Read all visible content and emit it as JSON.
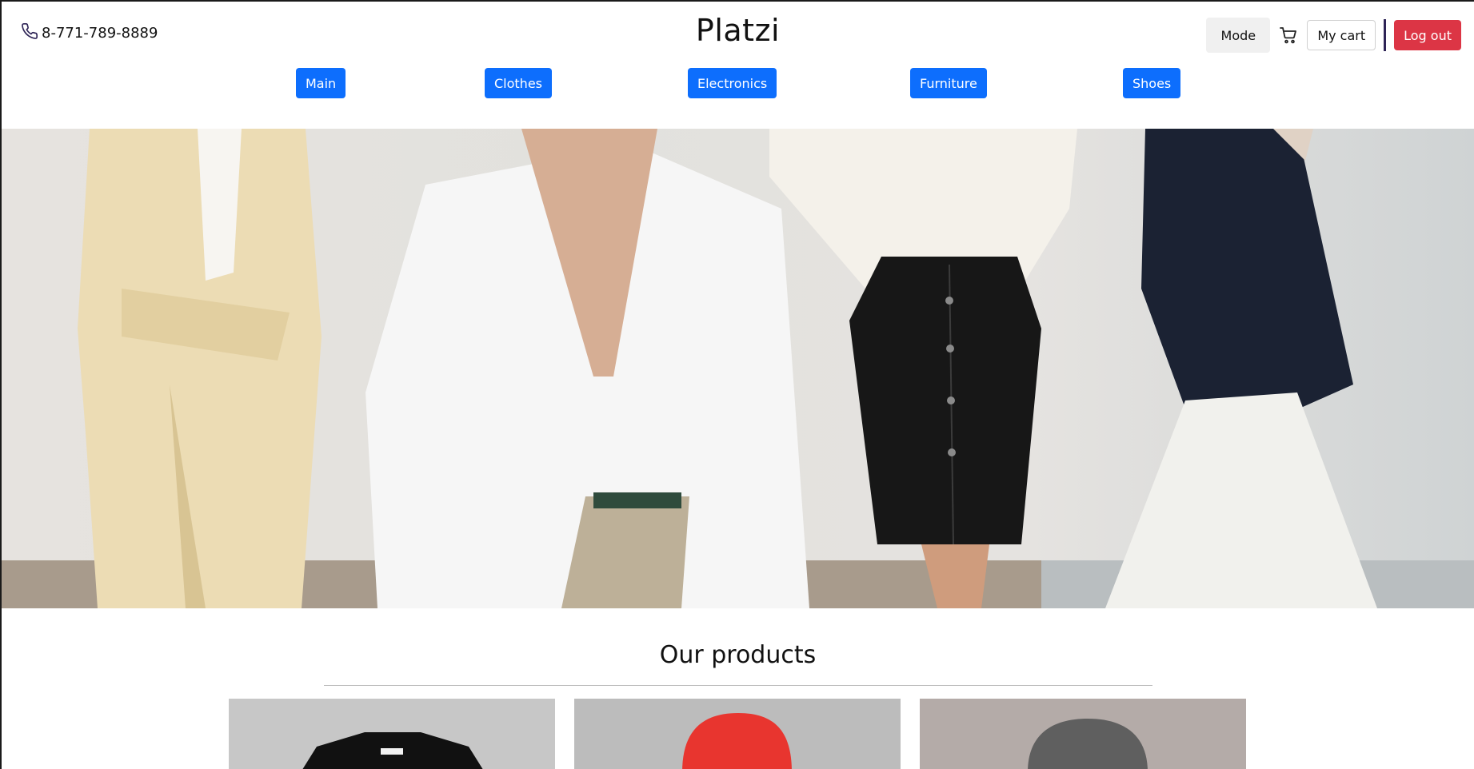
{
  "header": {
    "phone": "8-771-789-8889",
    "brand": "Platzi",
    "mode_label": "Mode",
    "cart_label": "My cart",
    "logout_label": "Log out"
  },
  "nav": {
    "categories": [
      "Main",
      "Clothes",
      "Electronics",
      "Furniture",
      "Shoes"
    ]
  },
  "products": {
    "title": "Our products",
    "items": [
      {
        "icon": "black-tshirt-image"
      },
      {
        "icon": "red-hoodie-image"
      },
      {
        "icon": "grey-hoodie-image"
      }
    ]
  },
  "colors": {
    "primary": "#0d6efd",
    "danger": "#dc3545",
    "mode_bg": "#f0f0f0",
    "divider": "#2e2456"
  }
}
